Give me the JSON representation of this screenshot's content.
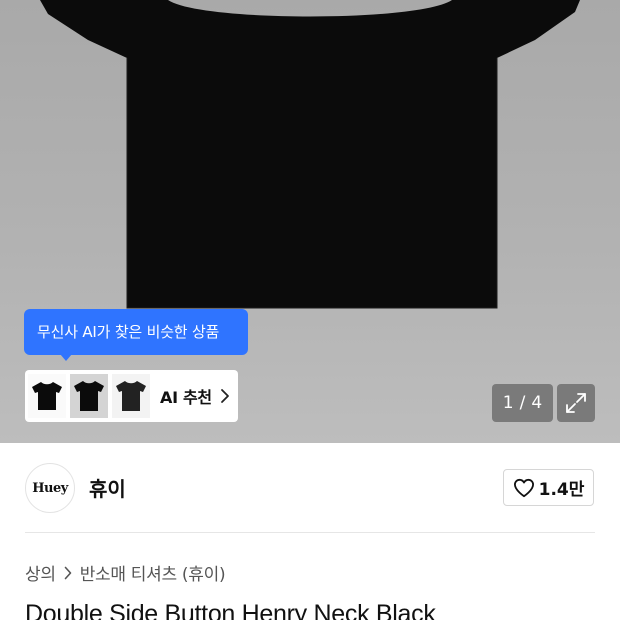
{
  "hero": {
    "ai_tooltip": "무신사 AI가 찾은 비슷한 상품",
    "ai_strip_label": "AI 추천",
    "counter": {
      "current": "1",
      "separator": "/",
      "total": "4"
    }
  },
  "brand": {
    "logo_text": "Huey",
    "name": "휴이",
    "like_count": "1.4만"
  },
  "breadcrumb": {
    "items": [
      "상의",
      "반소매 티셔츠 (휴이)"
    ]
  },
  "product": {
    "title": "Double Side Button Henry Neck Black"
  },
  "icons": {
    "like": "heart-outline-icon",
    "expand": "expand-arrows-icon",
    "chevron": "chevron-right-icon"
  },
  "colors": {
    "accent_blue": "#2f74ff",
    "shirt": "#0b0b0b",
    "hero_bg": "#b0b0b0"
  }
}
